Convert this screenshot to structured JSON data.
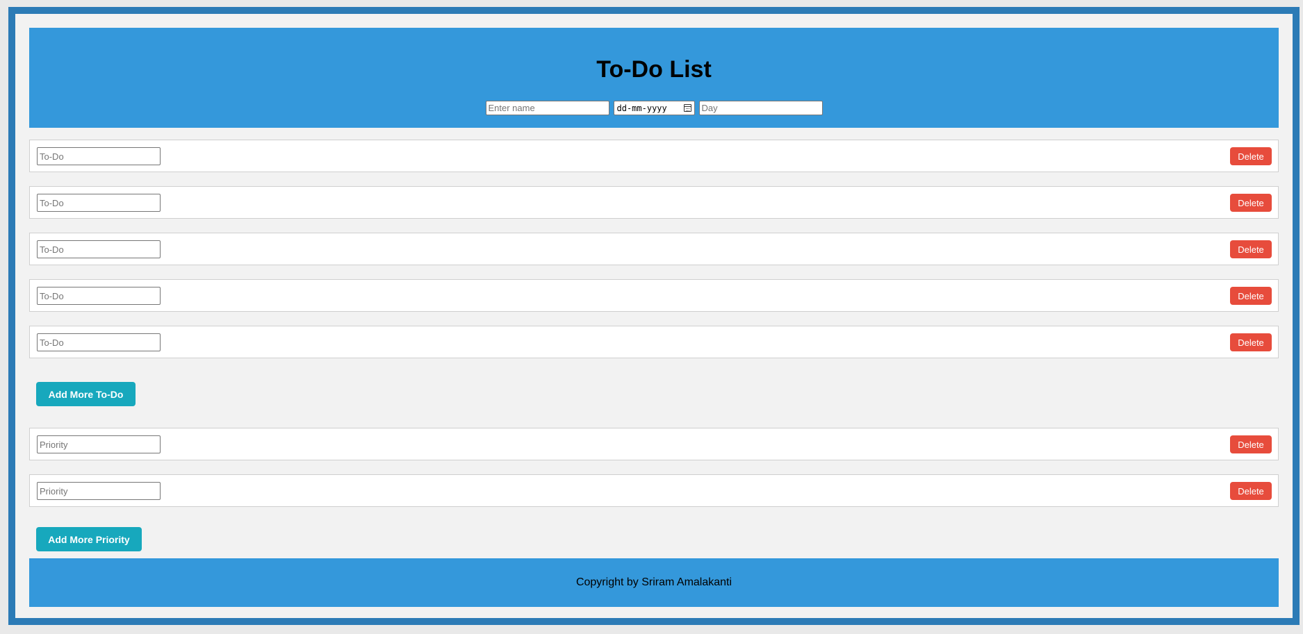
{
  "header": {
    "title": "To-Do List",
    "name_placeholder": "Enter name",
    "date_placeholder": "dd-mm-yyyy",
    "day_placeholder": "Day"
  },
  "todos": [
    {
      "placeholder": "To-Do",
      "value": "",
      "delete_label": "Delete"
    },
    {
      "placeholder": "To-Do",
      "value": "",
      "delete_label": "Delete"
    },
    {
      "placeholder": "To-Do",
      "value": "",
      "delete_label": "Delete"
    },
    {
      "placeholder": "To-Do",
      "value": "",
      "delete_label": "Delete"
    },
    {
      "placeholder": "To-Do",
      "value": "",
      "delete_label": "Delete"
    }
  ],
  "add_todo_label": "Add More To-Do",
  "priorities": [
    {
      "placeholder": "Priority",
      "value": "",
      "delete_label": "Delete"
    },
    {
      "placeholder": "Priority",
      "value": "",
      "delete_label": "Delete"
    }
  ],
  "add_priority_label": "Add More Priority",
  "footer": {
    "text": "Copyright by Sriram Amalakanti"
  },
  "colors": {
    "outer_border": "#2c7bb6",
    "header_bg": "#3498db",
    "delete_bg": "#e74c3c",
    "add_bg": "#17a8bd",
    "page_bg": "#f2f2f2"
  }
}
